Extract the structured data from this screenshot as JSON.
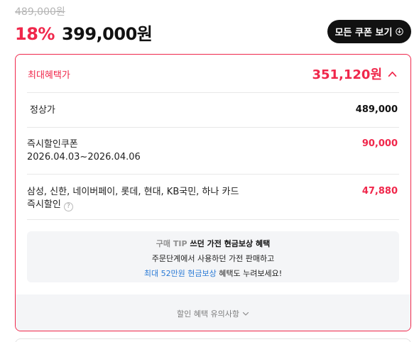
{
  "price": {
    "original": "489,000원",
    "discount_rate": "18%",
    "sale_price": "399,000원"
  },
  "coupon_button": {
    "label": "모든 쿠폰 보기",
    "icon": "download-icon"
  },
  "benefit": {
    "title": "최대혜택가",
    "value": "351,120원",
    "toggle_icon": "chevron-up-icon",
    "rows": [
      {
        "label": "정상가",
        "value": "489,000"
      },
      {
        "label": "즉시할인쿠폰",
        "sub": "2026.04.03~2026.04.06",
        "value": "90,000"
      },
      {
        "label": "삼성, 신한, 네이버페이, 롯데, 현대, KB국민, 하나 카드",
        "sub": "즉시할인",
        "value": "47,880"
      }
    ],
    "help_icon": "?"
  },
  "tip": {
    "prefix": "구매 TIP",
    "title": "쓰던 가전 현금보상 혜택",
    "line2": "주문단계에서 사용하던 가전 판매하고",
    "line3_highlight": "최대 52만원 현금보상",
    "line3_rest": " 혜택도 누려보세요!"
  },
  "notice": {
    "label": "할인 혜택 유의사항",
    "icon": "chevron-down-icon"
  },
  "colors": {
    "accent": "#f0274b",
    "link": "#2b7bd6",
    "panel": "#f4f5f7"
  }
}
